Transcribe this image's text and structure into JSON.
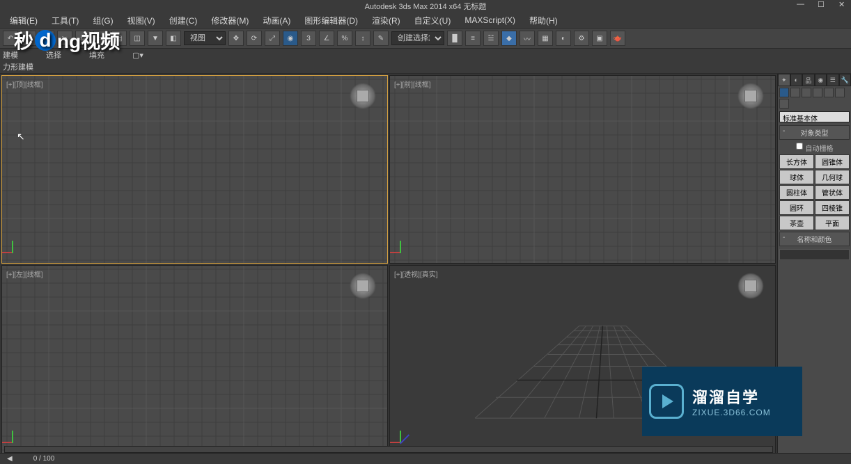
{
  "title": "Autodesk 3ds Max  2014 x64     无标题",
  "menus": {
    "m0": "编辑(E)",
    "m1": "工具(T)",
    "m2": "组(G)",
    "m3": "视图(V)",
    "m4": "创建(C)",
    "m5": "修改器(M)",
    "m6": "动画(A)",
    "m7": "图形编辑器(D)",
    "m8": "渲染(R)",
    "m9": "自定义(U)",
    "m10": "MAXScript(X)",
    "m11": "帮助(H)"
  },
  "toolbar": {
    "view_dropdown": "视图",
    "selset_dropdown": "创建选择集"
  },
  "tabs": {
    "t0": "建模",
    "t1": "选择",
    "t2": "填充"
  },
  "subtab": "力形建模",
  "viewports": {
    "top": "[+][顶][线框]",
    "front": "[+][前][线框]",
    "left": "[+][左][线框]",
    "persp": "[+][透视][真实]"
  },
  "panel": {
    "category": "标准基本体",
    "rollout_type": "对象类型",
    "auto_grid": "自动栅格",
    "btns": {
      "b0": "长方体",
      "b1": "圆锥体",
      "b2": "球体",
      "b3": "几何球",
      "b4": "圆柱体",
      "b5": "管状体",
      "b6": "圆环",
      "b7": "四棱锥",
      "b8": "茶壶",
      "b9": "平面"
    },
    "rollout_name": "名称和颜色"
  },
  "status": {
    "frame": "0 / 100"
  },
  "watermark": {
    "line1": "溜溜自学",
    "line2": "ZIXUE.3D66.COM"
  },
  "logo": {
    "text1": "秒",
    "text2": "d",
    "text3": "ng视频"
  }
}
